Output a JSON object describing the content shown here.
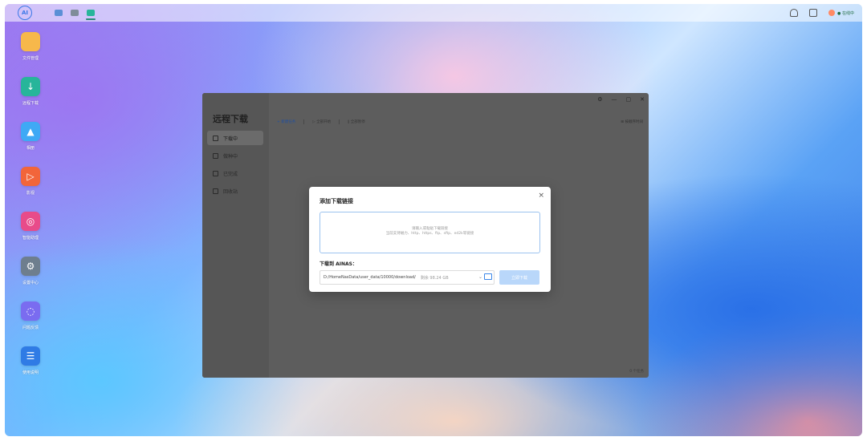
{
  "colors": {
    "accent": "#3a86e8",
    "window_bg": "#5d5d5d",
    "dialog_bg": "#ffffff",
    "primary_button_disabled": "#b9d7fa"
  },
  "topbar": {
    "logo_text": "AI",
    "task_icons": [
      "window-icon",
      "window-icon",
      "download-app-icon"
    ],
    "user_label": "● 在线中"
  },
  "desktop_apps": [
    {
      "label": "文件管理",
      "icon": "folder-icon",
      "color": "#f7b84b",
      "glyph": ""
    },
    {
      "label": "远程下载",
      "icon": "download-icon",
      "color": "#27b59a",
      "glyph": "↓"
    },
    {
      "label": "相册",
      "icon": "photo-icon",
      "color": "#3fa9f5",
      "glyph": "▲"
    },
    {
      "label": "影视",
      "icon": "play-icon",
      "color": "#f2653a",
      "glyph": "▷"
    },
    {
      "label": "智能助理",
      "icon": "chat-icon",
      "color": "#e84b8a",
      "glyph": "◎"
    },
    {
      "label": "设置中心",
      "icon": "settings-icon",
      "color": "#6e7e8e",
      "glyph": "⚙"
    },
    {
      "label": "问题反馈",
      "icon": "feedback-icon",
      "color": "#7a6cf0",
      "glyph": "◌"
    },
    {
      "label": "使用说明",
      "icon": "manual-icon",
      "color": "#2f7be5",
      "glyph": "☰"
    }
  ],
  "window": {
    "title": "远程下载",
    "nav": [
      {
        "label": "下载中",
        "icon": "download-icon",
        "active": true
      },
      {
        "label": "做种中",
        "icon": "seed-icon",
        "active": false
      },
      {
        "label": "已完成",
        "icon": "check-icon",
        "active": false
      },
      {
        "label": "回收站",
        "icon": "trash-icon",
        "active": false
      }
    ],
    "toolbar": {
      "new_task": "+ 新建任务",
      "start_all": "▷ 全部开始",
      "pause_all": "‖ 全部暂停"
    },
    "right_action": "⊞ 按顺序时间",
    "footer": "0 个任务"
  },
  "dialog": {
    "title": "添加下载链接",
    "close": "×",
    "placeholder_line1": "请输入或粘贴下载链接",
    "placeholder_line2": "当前支持磁力、http、https、ftp、sftp、ed2k等链接",
    "save_label": "下载到 AINAS：",
    "path": "D:/HomeNasData/user_data/10000/download/",
    "free_space": "剩余 98.24 GB",
    "confirm": "立即下载"
  }
}
